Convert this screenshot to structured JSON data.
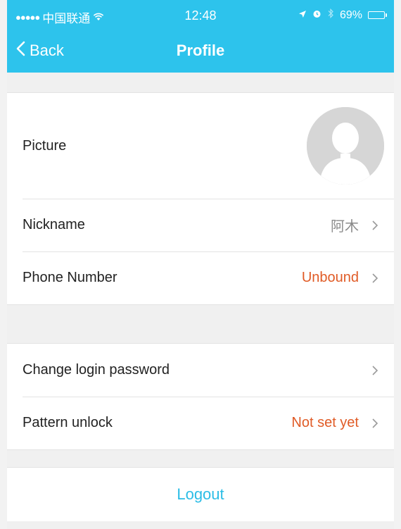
{
  "status_bar": {
    "signal": "●●●●●",
    "carrier": "中国联通",
    "wifi_icon": "wifi-icon",
    "time": "12:48",
    "battery_percent": "69%",
    "battery_level": 0.69
  },
  "nav": {
    "back_label": "Back",
    "title": "Profile"
  },
  "profile": {
    "picture_label": "Picture",
    "nickname_label": "Nickname",
    "nickname_value": "阿木",
    "phone_label": "Phone Number",
    "phone_value": "Unbound"
  },
  "security": {
    "change_password_label": "Change login password",
    "pattern_unlock_label": "Pattern unlock",
    "pattern_unlock_value": "Not set yet"
  },
  "logout_label": "Logout",
  "colors": {
    "accent": "#2dc3ec",
    "warning": "#e05b26",
    "logout": "#2cbde6"
  }
}
